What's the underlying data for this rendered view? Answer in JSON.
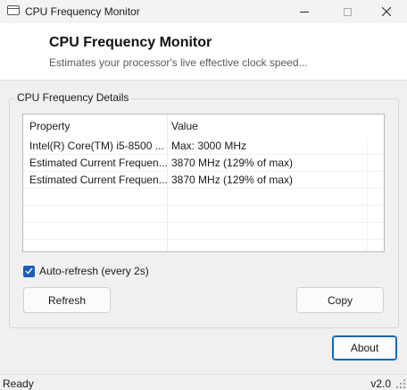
{
  "window": {
    "title": "CPU Frequency Monitor",
    "minimize_icon": "minimize-icon",
    "maximize_icon": "maximize-icon",
    "close_icon": "close-icon"
  },
  "header": {
    "title": "CPU Frequency Monitor",
    "subtitle": "Estimates your processor's live effective clock speed..."
  },
  "group": {
    "label": "CPU Frequency Details",
    "columns": [
      "Property",
      "Value"
    ],
    "rows": [
      {
        "property": "Intel(R) Core(TM) i5-8500 ...",
        "value": "Max: 3000 MHz"
      },
      {
        "property": "Estimated Current Frequen...",
        "value": "3870 MHz (129% of max)"
      },
      {
        "property": "Estimated Current Frequen...",
        "value": "3870 MHz (129% of max)"
      }
    ]
  },
  "auto_refresh": {
    "label": "Auto-refresh (every 2s)",
    "checked": true
  },
  "buttons": {
    "refresh": "Refresh",
    "copy": "Copy",
    "about": "About"
  },
  "status": {
    "text": "Ready",
    "version": "v2.0"
  },
  "colors": {
    "accent": "#0067c0",
    "checkbox": "#1d5cb8"
  }
}
